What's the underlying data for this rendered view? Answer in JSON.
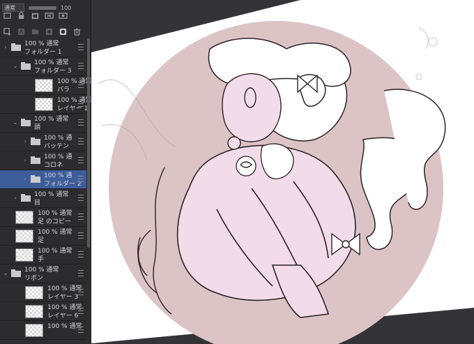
{
  "toolbar": {
    "blend_mode": "通常",
    "opacity_value": "100"
  },
  "layers": [
    {
      "kind": "folder",
      "depth": 0,
      "expanded": false,
      "line1": "100 % 通常",
      "line2": "フォルダー 1"
    },
    {
      "kind": "folder",
      "depth": 1,
      "expanded": true,
      "line1": "100 % 通常",
      "line2": "フォルダー 3"
    },
    {
      "kind": "layer",
      "depth": 2,
      "line1": "100 % 通常",
      "line2": "バラ"
    },
    {
      "kind": "layer",
      "depth": 2,
      "line1": "100 % 通常",
      "line2": "レイヤー 1"
    },
    {
      "kind": "folder",
      "depth": 1,
      "expanded": true,
      "line1": "100 % 通常",
      "line2": "頭"
    },
    {
      "kind": "folder",
      "depth": 2,
      "expanded": false,
      "line1": "100 % 通",
      "line2": "バッテン"
    },
    {
      "kind": "folder",
      "depth": 2,
      "expanded": false,
      "line1": "100 % 通",
      "line2": "コロネ"
    },
    {
      "kind": "folder",
      "depth": 2,
      "expanded": false,
      "selected": true,
      "line1": "100 % 通",
      "line2": "フォルダー 2"
    },
    {
      "kind": "folder",
      "depth": 1,
      "expanded": false,
      "line1": "100 % 通常",
      "line2": "目"
    },
    {
      "kind": "layer",
      "depth": 0,
      "line1": "100 % 通常",
      "line2": "足 のコピー"
    },
    {
      "kind": "layer",
      "depth": 0,
      "line1": "100 % 通常",
      "line2": "足"
    },
    {
      "kind": "layer",
      "depth": 0,
      "line1": "100 % 通常",
      "line2": "手"
    },
    {
      "kind": "folder",
      "depth": 0,
      "expanded": true,
      "line1": "100 % 通常",
      "line2": "リボン"
    },
    {
      "kind": "layer",
      "depth": 1,
      "line1": "100 % 通常",
      "line2": "レイヤー 3"
    },
    {
      "kind": "layer",
      "depth": 1,
      "line1": "100 % 通常",
      "line2": "レイヤー 6"
    },
    {
      "kind": "layer",
      "depth": 1,
      "line1": "100 % 通常",
      "line2": ""
    }
  ],
  "colors": {
    "panel_bg": "#2c2c2f",
    "selected_row": "#3d5c9a",
    "canvas_circle": "#dcc3c6",
    "dress_pink": "#f3dcea",
    "workspace": "#343438"
  },
  "icons": [
    "lock-icon",
    "clipping-icon",
    "reference-icon",
    "new-raster-layer-icon",
    "new-vector-layer-icon",
    "new-folder-icon",
    "mask-icon",
    "delete-icon"
  ]
}
